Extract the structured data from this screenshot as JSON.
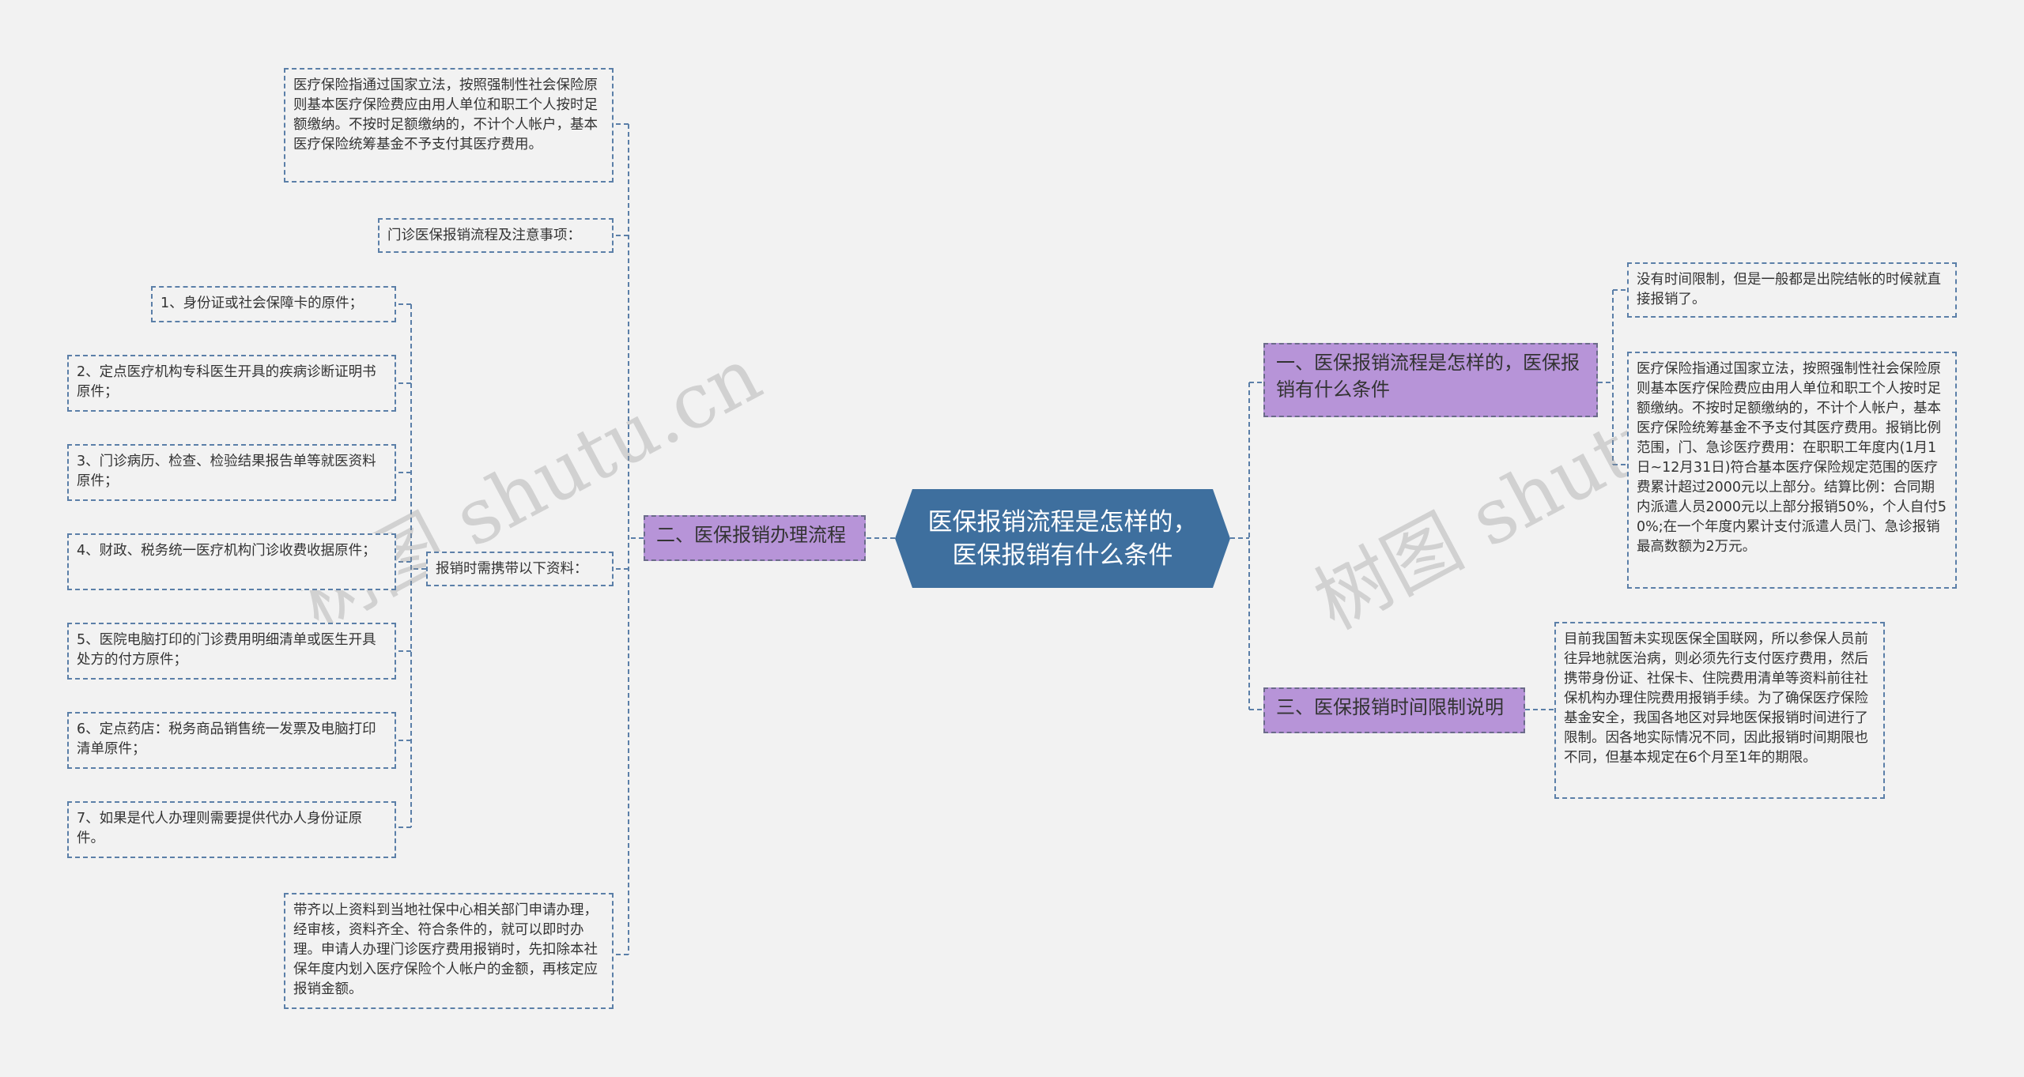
{
  "watermark": "树图 shutu.cn",
  "root": {
    "text": "医保报销流程是怎样的，\n医保报销有什么条件"
  },
  "left_branch": {
    "title": "二、医保报销办理流程",
    "intro": "医疗保险指通过国家立法，按照强制性社会保险原则基本医疗保险费应由用人单位和职工个人按时足额缴纳。不按时足额缴纳的，不计个人帐户，基本医疗保险统筹基金不予支付其医疗费用。",
    "outpatient": "门诊医保报销流程及注意事项：",
    "materials_label": "报销时需携带以下资料：",
    "materials": [
      "1、身份证或社会保障卡的原件；",
      "2、定点医疗机构专科医生开具的疾病诊断证明书原件；",
      "3、门诊病历、检查、检验结果报告单等就医资料原件；",
      "4、财政、税务统一医疗机构门诊收费收据原件；",
      "5、医院电脑打印的门诊费用明细清单或医生开具处方的付方原件；",
      "6、定点药店：税务商品销售统一发票及电脑打印清单原件；",
      "7、如果是代人办理则需要提供代办人身份证原件。"
    ],
    "closing": "带齐以上资料到当地社保中心相关部门申请办理，经审核，资料齐全、符合条件的，就可以即时办理。申请人办理门诊医疗费用报销时，先扣除本社保年度内划入医疗保险个人帐户的金额，再核定应报销金额。"
  },
  "right_branches": [
    {
      "title": "一、医保报销流程是怎样的，医保报销有什么条件",
      "children": [
        "没有时间限制，但是一般都是出院结帐的时候就直接报销了。",
        "医疗保险指通过国家立法，按照强制性社会保险原则基本医疗保险费应由用人单位和职工个人按时足额缴纳。不按时足额缴纳的，不计个人帐户，基本医疗保险统筹基金不予支付其医疗费用。报销比例范围，门、急诊医疗费用：在职职工年度内(1月1日~12月31日)符合基本医疗保险规定范围的医疗费累计超过2000元以上部分。结算比例：合同期内派遣人员2000元以上部分报销50%，个人自付50%;在一个年度内累计支付派遣人员门、急诊报销最高数额为2万元。"
      ]
    },
    {
      "title": "三、医保报销时间限制说明",
      "children": [
        "目前我国暂未实现医保全国联网，所以参保人员前往异地就医治病，则必须先行支付医疗费用，然后携带身份证、社保卡、住院费用清单等资料前往社保机构办理住院费用报销手续。为了确保医疗保险基金安全，我国各地区对异地医保报销时间进行了限制。因各地实际情况不同，因此报销时间期限也不同，但基本规定在6个月至1年的期限。"
      ]
    }
  ],
  "colors": {
    "background": "#f2f2f2",
    "root_fill": "#3e6f9e",
    "branch_fill": "#b794d8",
    "connector": "#5b7fa8"
  }
}
